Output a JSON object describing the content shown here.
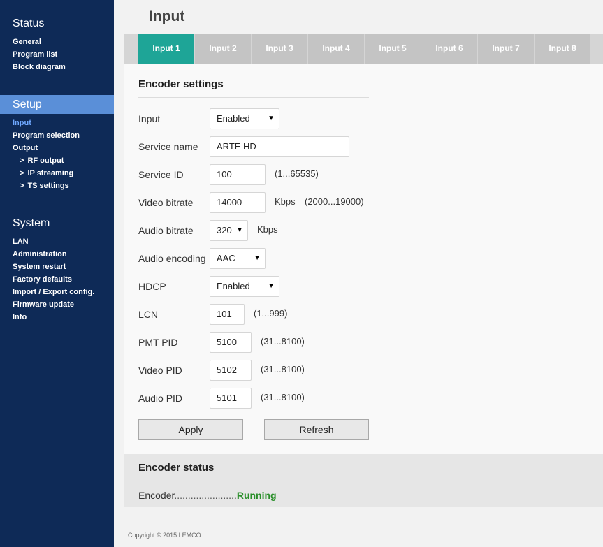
{
  "page_title": "Input",
  "sidebar": {
    "status": {
      "title": "Status",
      "items": [
        "General",
        "Program list",
        "Block diagram"
      ]
    },
    "setup": {
      "title": "Setup",
      "items": [
        "Input",
        "Program selection",
        "Output"
      ],
      "subitems": [
        "RF output",
        "IP streaming",
        "TS settings"
      ],
      "sub_prefix": ">"
    },
    "system": {
      "title": "System",
      "items": [
        "LAN",
        "Administration",
        "System restart",
        "Factory defaults",
        "Import / Export config.",
        "Firmware update",
        "Info"
      ]
    }
  },
  "tabs": [
    "Input 1",
    "Input 2",
    "Input 3",
    "Input 4",
    "Input 5",
    "Input 6",
    "Input 7",
    "Input 8"
  ],
  "encoder_settings": {
    "title": "Encoder settings",
    "input": {
      "label": "Input",
      "value": "Enabled"
    },
    "service_name": {
      "label": "Service name",
      "value": "ARTE HD"
    },
    "service_id": {
      "label": "Service ID",
      "value": "100",
      "range": "(1...65535)"
    },
    "video_bitrate": {
      "label": "Video bitrate",
      "value": "14000",
      "unit": "Kbps",
      "range": "(2000...19000)"
    },
    "audio_bitrate": {
      "label": "Audio bitrate",
      "value": "320",
      "unit": "Kbps"
    },
    "audio_encoding": {
      "label": "Audio encoding",
      "value": "AAC"
    },
    "hdcp": {
      "label": "HDCP",
      "value": "Enabled"
    },
    "lcn": {
      "label": "LCN",
      "value": "101",
      "range": "(1...999)"
    },
    "pmt_pid": {
      "label": "PMT PID",
      "value": "5100",
      "range": "(31...8100)"
    },
    "video_pid": {
      "label": "Video PID",
      "value": "5102",
      "range": "(31...8100)"
    },
    "audio_pid": {
      "label": "Audio PID",
      "value": "5101",
      "range": "(31...8100)"
    },
    "apply_label": "Apply",
    "refresh_label": "Refresh"
  },
  "encoder_status": {
    "title": "Encoder status",
    "label": "Encoder",
    "dots": ".......................",
    "value": "Running"
  },
  "copyright": "Copyright © 2015 LEMCO",
  "colors": {
    "sidebar_bg": "#0e2a57",
    "sidebar_active_bg": "#5a8fd8",
    "sidebar_active_text": "#6fa8ff",
    "tab_active": "#1ea597",
    "tab_inactive": "#c4c4c4",
    "status_running": "#2a8f2a"
  }
}
